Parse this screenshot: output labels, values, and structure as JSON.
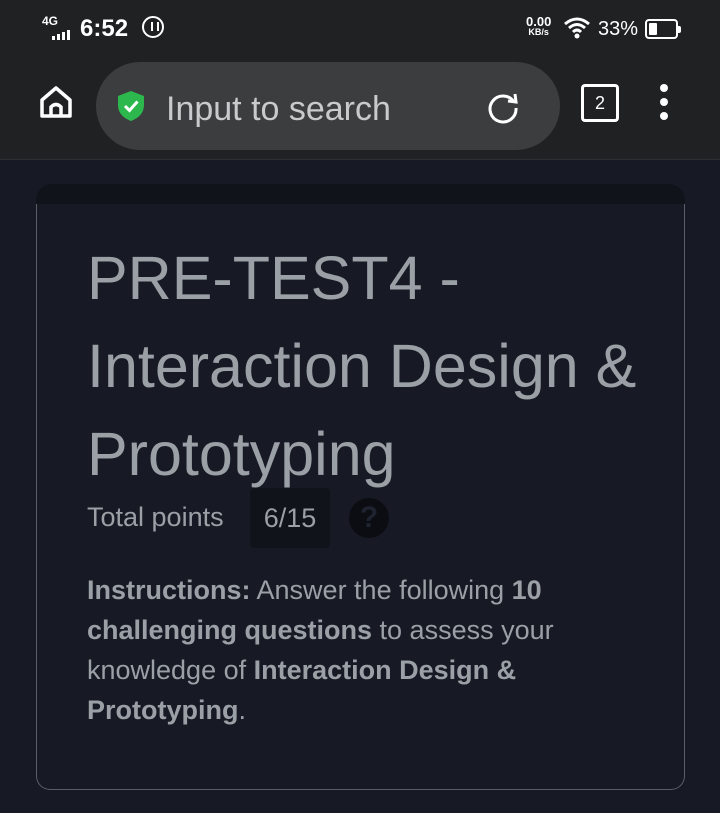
{
  "status_bar": {
    "network": "4G",
    "time": "6:52",
    "speed_value": "0.00",
    "speed_unit": "KB/s",
    "battery_pct": "33%",
    "battery_level": 0.33
  },
  "browser": {
    "url_placeholder": "Input to search",
    "tab_count": "2",
    "colors": {
      "shield": "#2db84d"
    }
  },
  "quiz": {
    "title": "PRE-TEST4 - Interaction Design & Prototyping",
    "points_label": "Total points",
    "points_value": "6/15",
    "help_symbol": "?",
    "instructions": {
      "lead": "Instructions:",
      "t1": " Answer the following ",
      "b1": "10 challenging questions",
      "t2": " to assess your knowledge of ",
      "b2": "Interaction Design & Prototyping",
      "t3": "."
    }
  }
}
